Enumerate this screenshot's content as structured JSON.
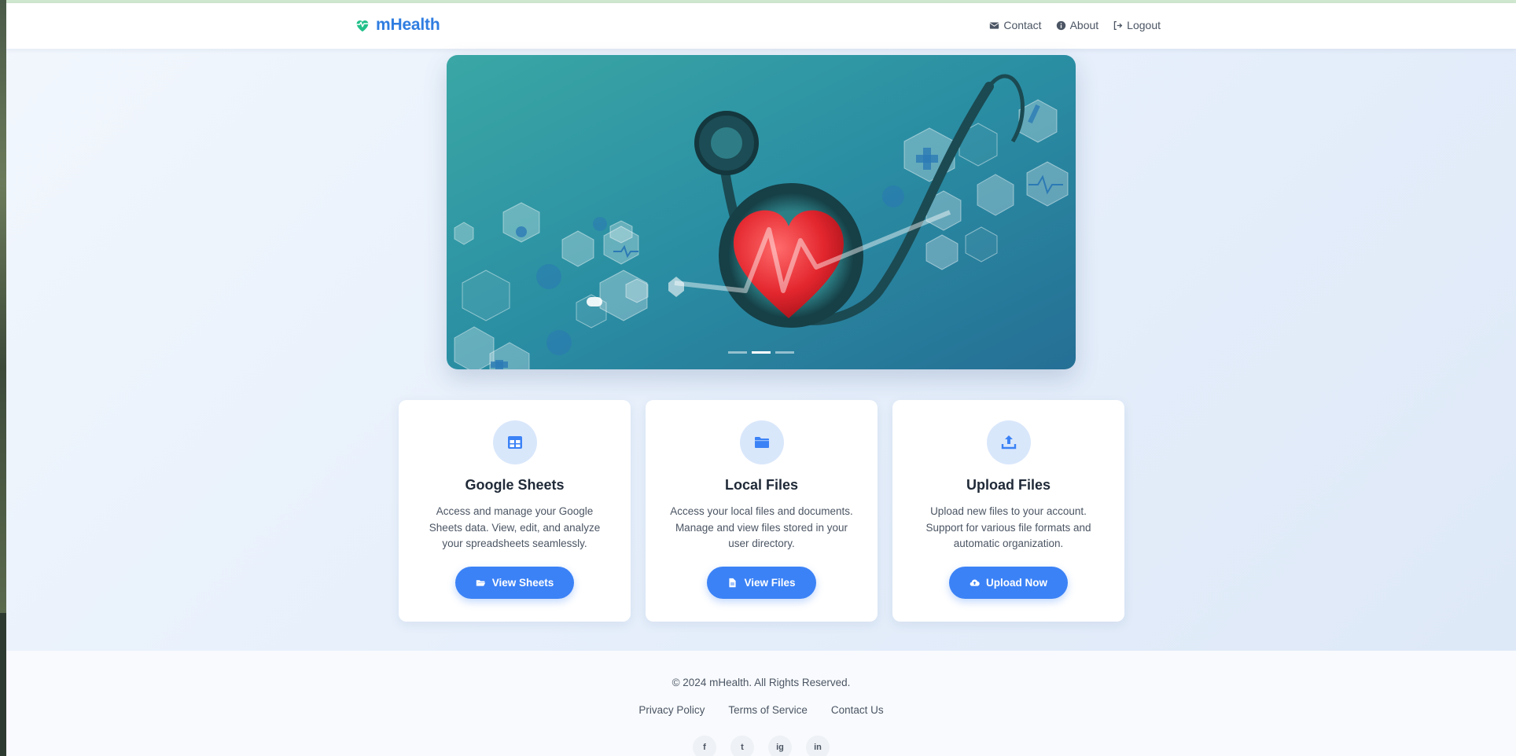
{
  "brand": {
    "name": "mHealth",
    "color": "#2f7de1",
    "logo_icon": "heart-pulse-icon",
    "logo_color": "#22c08a"
  },
  "nav": {
    "items": [
      {
        "label": "Contact",
        "icon": "envelope-icon"
      },
      {
        "label": "About",
        "icon": "info-circle-icon"
      },
      {
        "label": "Logout",
        "icon": "sign-out-icon"
      }
    ]
  },
  "hero": {
    "image": "stethoscope with red heart and medical hexagon icons on teal background",
    "slides_total": 3,
    "active_slide": 2
  },
  "cards": [
    {
      "title": "Google Sheets",
      "description": "Access and manage your Google Sheets data. View, edit, and analyze your spreadsheets seamlessly.",
      "icon": "table-icon",
      "button": {
        "label": "View Sheets",
        "icon": "folder-open-icon"
      }
    },
    {
      "title": "Local Files",
      "description": "Access your local files and documents. Manage and view files stored in your user directory.",
      "icon": "folder-icon",
      "button": {
        "label": "View Files",
        "icon": "file-icon"
      }
    },
    {
      "title": "Upload Files",
      "description": "Upload new files to your account. Support for various file formats and automatic organization.",
      "icon": "upload-icon",
      "button": {
        "label": "Upload Now",
        "icon": "cloud-upload-icon"
      }
    }
  ],
  "footer": {
    "copyright": "© 2024 mHealth. All Rights Reserved.",
    "links": [
      "Privacy Policy",
      "Terms of Service",
      "Contact Us"
    ],
    "socials": [
      {
        "label": "f",
        "icon": "facebook-icon"
      },
      {
        "label": "t",
        "icon": "twitter-icon"
      },
      {
        "label": "ig",
        "icon": "instagram-icon"
      },
      {
        "label": "in",
        "icon": "linkedin-icon"
      }
    ]
  },
  "colors": {
    "accent": "#3b82f6",
    "icon_bg": "#d9e7fb",
    "text": "#1f2937",
    "muted": "#4b5563"
  }
}
